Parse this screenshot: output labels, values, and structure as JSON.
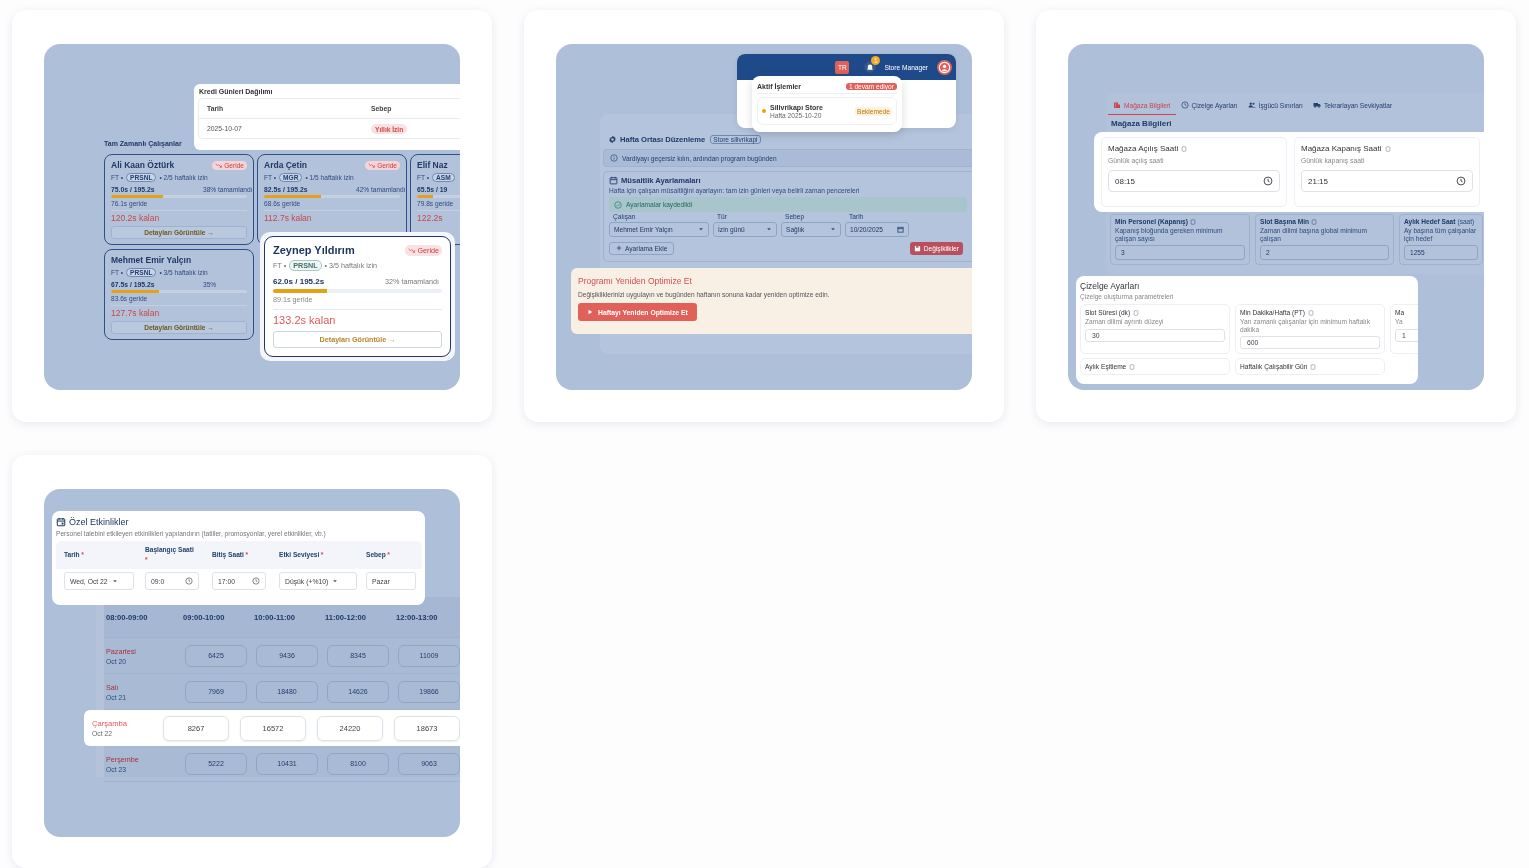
{
  "employee_panel": {
    "section_title": "Tam Zamanlı Çalışanlar",
    "employees": [
      {
        "name": "Ali Kaan Öztürk",
        "status": "Geride",
        "type": "FT •",
        "role": "PRSNL",
        "leave": "• 2/5 haftalık izin",
        "hours": "75.0s / 195.2s",
        "percent": "38% tamamlandı",
        "level": 0.38,
        "behind": "76.1s geride",
        "remaining": "120.2s kalan",
        "button": "Detayları Görüntüle →"
      },
      {
        "name": "Arda Çetin",
        "status": "Geride",
        "type": "FT •",
        "role": "MGR",
        "leave": "• 1/5 haftalık izin",
        "hours": "82.5s / 195.2s",
        "percent": "42% tamamlandı",
        "level": 0.42,
        "behind": "68.6s geride",
        "remaining": "112.7s kalan"
      },
      {
        "name": "Elif Naz",
        "type": "FT •",
        "role": "ASM",
        "hours": "65.5s / 19",
        "level": 0.12,
        "behind": "79.8s geride",
        "remaining": "122.2s"
      },
      {
        "name": "Mehmet Emir Yalçın",
        "type": "FT •",
        "role": "PRSNL",
        "leave": "• 3/5 haftalık izin",
        "hours": "67.5s / 195.2s",
        "percent": "35%",
        "level": 0.35,
        "behind": "83.6s geride",
        "remaining": "127.7s kalan",
        "button": "Detayları Görüntüle →"
      }
    ],
    "credit_popup": {
      "title": "Kredi Günleri Dağılımı",
      "columns": [
        "Tarih",
        "Sebep"
      ],
      "rows": [
        {
          "date": "2025-10-07",
          "reason": "Yıllık İzin"
        }
      ]
    },
    "focus_employee": {
      "name": "Zeynep Yıldırım",
      "status": "Geride",
      "type": "FT •",
      "role": "PRSNL",
      "leave": "• 3/5 haftalık izin",
      "hours": "62.0s / 195.2s",
      "percent": "32% tamamlandı",
      "level": 0.32,
      "behind": "89.1s geride",
      "remaining": "133.2s kalan",
      "button": "Detayları Görüntüle →"
    }
  },
  "adjustment_panel": {
    "header": {
      "title": "Hafta Ortası Düzenleme",
      "store_badge": "Store silivrikapi",
      "info": "Vardiyayı geçersiz kılın, ardından program bugünden"
    },
    "availability": {
      "title": "Müsaitlik Ayarlamaları",
      "description": "Hafta için çalışan müsaitliğini ayarlayın: tam izin günleri veya belirli zaman pencereleri",
      "success": "Ayarlamalar kaydedildi",
      "fields": [
        {
          "label": "Çalışan",
          "value": "Mehmet Emir Yalçın",
          "kind": "select"
        },
        {
          "label": "Tür",
          "value": "İzin günü",
          "kind": "select"
        },
        {
          "label": "Sebep",
          "value": "Sağlık",
          "kind": "select"
        },
        {
          "label": "Tarih",
          "value": "10/20/2025",
          "kind": "date"
        }
      ],
      "add_button": "Ayarlama Ekle",
      "save_button": "Değişiklikler"
    },
    "top_bar": {
      "language": "TR",
      "notification_count": "1",
      "user": "Store Manager"
    },
    "active_jobs": {
      "title": "Aktif İşlemler",
      "count_badge": "1 devam ediyor",
      "jobs": [
        {
          "store": "Silivrikapı Store",
          "week": "Hafta 2025-10-20",
          "status": "Beklemede",
          "color": "#f59e0b"
        }
      ]
    },
    "reoptimize": {
      "title": "Programı Yeniden Optimize Et",
      "description": "Değişikliklerinizi uygulayın ve bugünden haftanın sonuna kadar yeniden optimize edin.",
      "button": "Haftayı Yeniden Optimize Et"
    }
  },
  "store_settings_panel": {
    "tabs": [
      {
        "label": "Mağaza Bilgileri",
        "selected": true
      },
      {
        "label": "Çizelge Ayarları",
        "selected": false
      },
      {
        "label": "İşgücü Sınırları",
        "selected": false
      },
      {
        "label": "Tekrarlayan Sevkiyatlar",
        "selected": false
      }
    ],
    "section_title": "Mağaza Bilgileri",
    "hours": [
      {
        "label": "Mağaza Açılış Saati",
        "hint": "Günlük açılış saati",
        "value": "08:15"
      },
      {
        "label": "Mağaza Kapanış Saati",
        "hint": "Günlük kapanış saati",
        "value": "21:15"
      }
    ],
    "limits": [
      {
        "label": "Min Personel (Kapanış)",
        "hint": "Kapanış bloğunda gereken minimum çalışan sayısı",
        "value": "3"
      },
      {
        "label": "Slot Başına Min",
        "hint": "Zaman dilimi başına global minimum çalışan",
        "value": "2"
      },
      {
        "label": "Aylık Hedef Saat",
        "unit": "(saat)",
        "hint": "Ay başına tüm çalışanlar için hedef",
        "value": "1255"
      }
    ],
    "schedule": {
      "title": "Çizelge Ayarları",
      "subtitle": "Çizelge oluşturma parametreleri",
      "fields": [
        {
          "label": "Slot Süresi (dk)",
          "hint": "Zaman dilimi ayrıntı düzeyi",
          "value": "30"
        },
        {
          "label": "Min Dakika/Hafta (PT)",
          "hint": "Yarı zamanlı çalışanlar için minimum haftalık dakika",
          "value": "600"
        },
        {
          "label": "Ma",
          "hint": "Ya",
          "value": "1"
        },
        {
          "label": "Aylık Eşitleme"
        },
        {
          "label": "Haftalık Çalışabilir Gün"
        }
      ]
    }
  },
  "events_panel": {
    "title": "Özel Etkinlikler",
    "description": "Personel talebini etkileyen etkinlikleri yapılandırın (tatiller, promosyonlar, yerel etkinlikler, vb.)",
    "columns": [
      {
        "label": "Tarih",
        "required_mark": "*"
      },
      {
        "label": "Başlangıç Saati",
        "required_mark": "*"
      },
      {
        "label": "Bitiş Saati",
        "required_mark": "*"
      },
      {
        "label": "Etki Seviyesi",
        "required_mark": "*"
      },
      {
        "label": "Sebep",
        "required_mark": "*"
      }
    ],
    "values": [
      {
        "value": "Wed, Oct 22",
        "kind": "select"
      },
      {
        "value": "09:0",
        "kind": "time"
      },
      {
        "value": "17:00",
        "kind": "time"
      },
      {
        "value": "Düşük (+%10)",
        "kind": "select"
      },
      {
        "value": "Pazar",
        "kind": "text"
      }
    ],
    "demand_table": {
      "time_slots": [
        "08:00-09:00",
        "09:00-10:00",
        "10:00-11:00",
        "11:00-12:00",
        "12:00-13:00"
      ],
      "rows": [
        {
          "day": "Pazartesi",
          "date": "Oct 20",
          "values": [
            "6425",
            "9436",
            "8345",
            "11009"
          ],
          "selected": false
        },
        {
          "day": "Salı",
          "date": "Oct 21",
          "values": [
            "7969",
            "18480",
            "14626",
            "19866"
          ],
          "selected": false
        },
        {
          "day": "Çarşamba",
          "date": "Oct 22",
          "values": [
            "8267",
            "16572",
            "24220",
            "18673"
          ],
          "selected": true
        },
        {
          "day": "Perşembe",
          "date": "Oct 23",
          "values": [
            "5222",
            "10431",
            "8100",
            "9063"
          ],
          "selected": false
        }
      ]
    }
  }
}
